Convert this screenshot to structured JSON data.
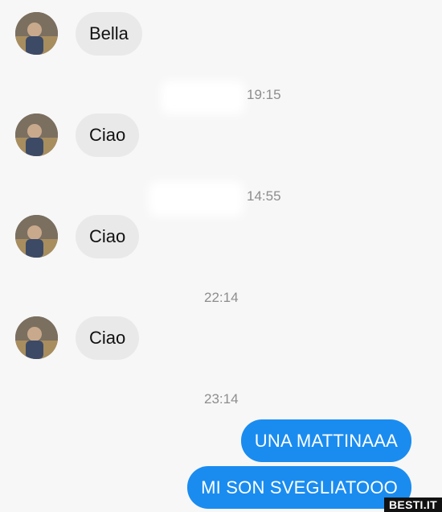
{
  "conversation": {
    "messages": [
      {
        "text": "Bella"
      },
      {
        "timestamp": "19:15"
      },
      {
        "text": "Ciao"
      },
      {
        "timestamp": "14:55"
      },
      {
        "text": "Ciao"
      },
      {
        "timestamp": "22:14"
      },
      {
        "text": "Ciao"
      },
      {
        "timestamp": "23:14"
      },
      {
        "text": "UNA MATTINAAA"
      },
      {
        "text": "MI SON SVEGLIATOOO"
      }
    ]
  },
  "watermark": "BESTI.IT",
  "colors": {
    "incoming_bubble": "#e9e9ea",
    "outgoing_bubble": "#1a8cf0",
    "background": "#f7f7f7",
    "timestamp_text": "#8d8d8d"
  }
}
